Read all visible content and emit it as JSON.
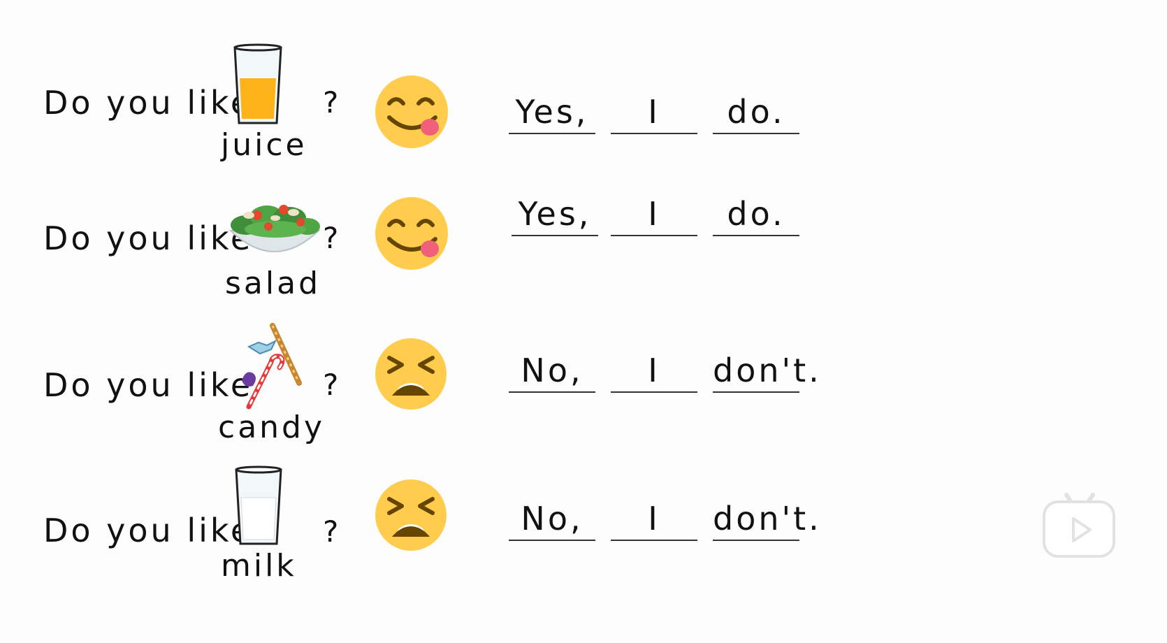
{
  "rows": [
    {
      "question": "Do you like",
      "food": "juice",
      "mark": "?",
      "face": "smiling-tongue-face-icon",
      "answer": [
        "Yes,",
        "I",
        "do."
      ]
    },
    {
      "question": "Do you like",
      "food": "salad",
      "mark": "?",
      "face": "smiling-tongue-face-icon",
      "answer": [
        "Yes,",
        "I",
        "do."
      ]
    },
    {
      "question": "Do you like",
      "food": "candy",
      "mark": "?",
      "face": "tired-face-icon",
      "answer": [
        "No,",
        "I",
        "don't."
      ]
    },
    {
      "question": "Do you like",
      "food": "milk",
      "mark": "?",
      "face": "tired-face-icon",
      "answer": [
        "No,",
        "I",
        "don't."
      ]
    }
  ],
  "player": {
    "icon": "play-icon"
  },
  "colors": {
    "emoji": "#ffcc4d",
    "emoji_dark": "#664500",
    "juice": "#ffb31a",
    "tongue": "#f0607a",
    "play_border": "#e2e2e2"
  }
}
